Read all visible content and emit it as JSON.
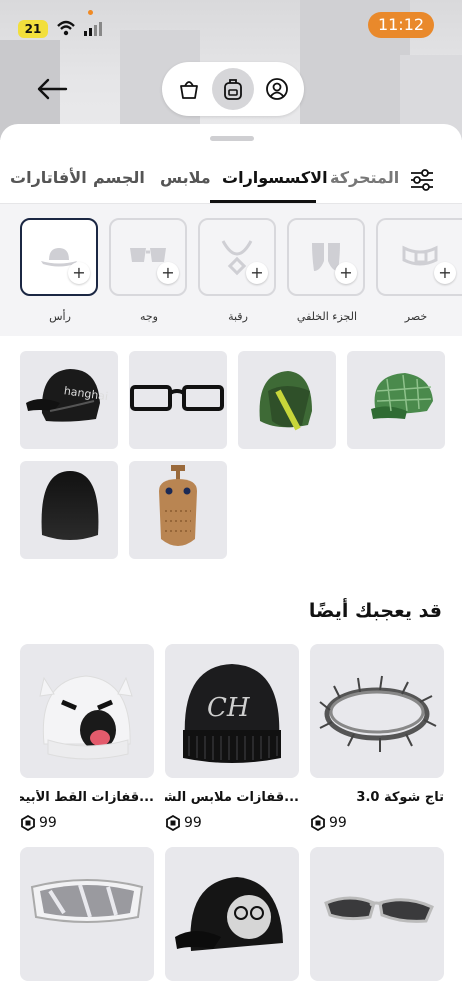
{
  "status": {
    "battery": "21",
    "time": "11:12"
  },
  "nav": {
    "back_icon": "arrow-left-icon",
    "segments": [
      {
        "icon": "shopping-bag-icon"
      },
      {
        "icon": "backpack-icon",
        "active": true
      },
      {
        "icon": "avatar-icon"
      }
    ]
  },
  "tabs": [
    {
      "label": "الأفاتارات"
    },
    {
      "label": "الجسم"
    },
    {
      "label": "ملابس"
    },
    {
      "label": "الاكسسوارات",
      "active": true
    },
    {
      "label": "المتحركة"
    }
  ],
  "subcategories": [
    {
      "label": "رأس",
      "icon": "hat-icon",
      "selected": true
    },
    {
      "label": "وجه",
      "icon": "glasses-icon"
    },
    {
      "label": "رقبة",
      "icon": "necklace-icon"
    },
    {
      "label": "الجزء الخلفي",
      "icon": "back-accessory-icon"
    },
    {
      "label": "خصر",
      "icon": "belt-icon"
    }
  ],
  "owned_items": [
    {
      "icon": "shanghai-cap-icon"
    },
    {
      "icon": "black-glasses-icon"
    },
    {
      "icon": "green-hood-icon"
    },
    {
      "icon": "green-plaid-cap-icon"
    },
    {
      "icon": "black-hair-icon"
    },
    {
      "icon": "leather-mask-icon"
    }
  ],
  "recommendations": {
    "title": "قد يعجبك أيضًا",
    "items": [
      {
        "name": "...قفازات القط الأبيض",
        "price": "99",
        "icon": "white-ghost-beanie-icon"
      },
      {
        "name": "...قفازات ملابس الشوار",
        "price": "99",
        "icon": "black-ch-beanie-icon"
      },
      {
        "name": "تاج شوكة 3.0",
        "price": "99",
        "icon": "thorn-crown-icon"
      },
      {
        "name": "",
        "price": "",
        "icon": "ski-goggles-icon"
      },
      {
        "name": "",
        "price": "",
        "icon": "cat-cap-icon"
      },
      {
        "name": "",
        "price": "",
        "icon": "silver-sunglasses-icon"
      }
    ]
  }
}
